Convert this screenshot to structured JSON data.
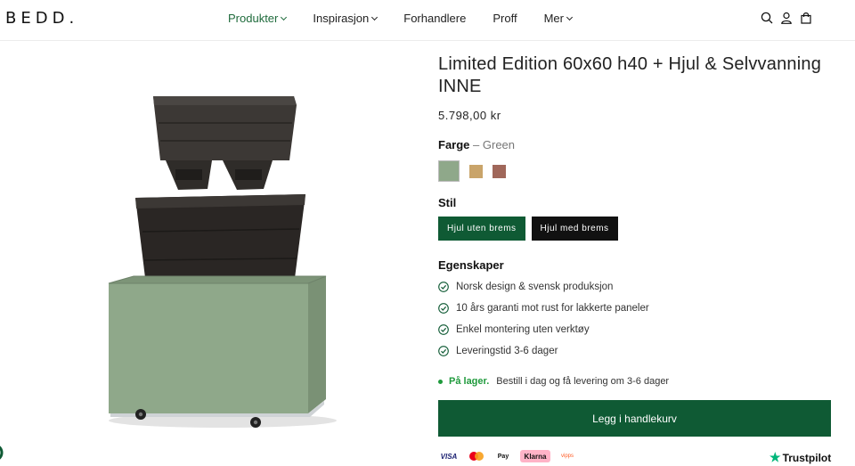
{
  "header": {
    "logo": "BEDD.",
    "nav": [
      {
        "label": "Produkter",
        "dropdown": true,
        "active": true
      },
      {
        "label": "Inspirasjon",
        "dropdown": true,
        "active": false
      },
      {
        "label": "Forhandlere",
        "dropdown": false,
        "active": false
      },
      {
        "label": "Proff",
        "dropdown": false,
        "active": false
      },
      {
        "label": "Mer",
        "dropdown": true,
        "active": false
      }
    ],
    "icons": [
      "search-icon",
      "account-icon",
      "cart-icon"
    ]
  },
  "product": {
    "title": "Limited Edition 60x60 h40 + Hjul & Selvvanning INNE",
    "price": "5.798,00 kr",
    "color_label": "Farge",
    "color_separator": "–",
    "color_selected": "Green",
    "swatches": [
      {
        "name": "Green",
        "color": "#8fa88a",
        "active": true
      },
      {
        "name": "Sand",
        "color": "#c9a46a",
        "active": false
      },
      {
        "name": "Rust",
        "color": "#a0675a",
        "active": false
      }
    ],
    "style_label": "Stil",
    "style_options": [
      {
        "label": "Hjul uten brems",
        "color": "#0f5a34"
      },
      {
        "label": "Hjul med brems",
        "color": "#111111"
      }
    ],
    "features_title": "Egenskaper",
    "features": [
      "Norsk design & svensk produksjon",
      "10 års garanti mot rust for lakkerte paneler",
      "Enkel montering uten verktøy",
      "Leveringstid 3-6 dager"
    ],
    "stock_status": "På lager.",
    "stock_note": "Bestill i dag og få levering om 3-6 dager",
    "stock_color": "#1f9a3c",
    "cart_button": "Legg i handlekurv"
  },
  "payments": [
    "VISA",
    "Mastercard",
    "Apple Pay",
    "Klarna",
    "Vipps"
  ],
  "trustpilot": "Trustpilot",
  "colors": {
    "accent": "#0f5a34",
    "planter_green": "#8fa88a"
  }
}
